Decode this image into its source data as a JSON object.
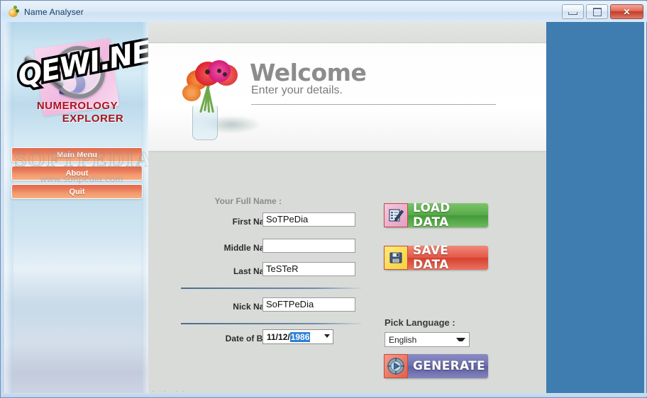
{
  "window": {
    "title": "Name Analyser",
    "icon": "app-icon",
    "buttons": {
      "minimize": "minimize-icon",
      "maximize": "maximize-icon",
      "close": "✕"
    }
  },
  "sidebar": {
    "logo": {
      "watermark": "QEWI.NET",
      "line1": "NUMEROLOGY",
      "line2": "EXPLORER",
      "glyph": "3"
    },
    "menu": [
      {
        "label": "Main Menu",
        "name": "main-menu"
      },
      {
        "label": "About",
        "name": "about"
      },
      {
        "label": "Quit",
        "name": "quit"
      }
    ],
    "watermark": {
      "big": "SOFTPEDIA",
      "small": "www.softpedia.com"
    }
  },
  "header": {
    "title": "Welcome",
    "subtitle": "Enter your details."
  },
  "form": {
    "section_label": "Your Full Name :",
    "fields": [
      {
        "label": "First Name :",
        "value": "SoTPeDia",
        "placeholder": ""
      },
      {
        "label": "Middle Name :",
        "value": "",
        "placeholder": ""
      },
      {
        "label": "Last Name :",
        "value": "TeSTeR",
        "placeholder": ""
      },
      {
        "label": "Nick Name :",
        "value": "SoFTPeDia",
        "placeholder": ""
      }
    ],
    "dob": {
      "label": "Date of Birth :",
      "value_prefix": "11/12/",
      "value_selected": "1986",
      "full_value": "11/12/1986"
    }
  },
  "actions": {
    "load": {
      "label": "LOAD DATA",
      "icon": "clipboard-pencil-icon",
      "color": "#4ca33d"
    },
    "save": {
      "label": "SAVE DATA",
      "icon": "floppy-disk-icon",
      "color": "#d6412f"
    },
    "generate": {
      "label": "GENERATE",
      "icon": "play-target-icon",
      "color": "#6f6fae"
    }
  },
  "language": {
    "label": "Pick Language :",
    "selected": "English"
  },
  "colors": {
    "right_panel": "#3f7cb0",
    "main_bg": "#d9dbd9",
    "accent_orange": "#e8795a",
    "selection_blue": "#2f7fd6"
  }
}
